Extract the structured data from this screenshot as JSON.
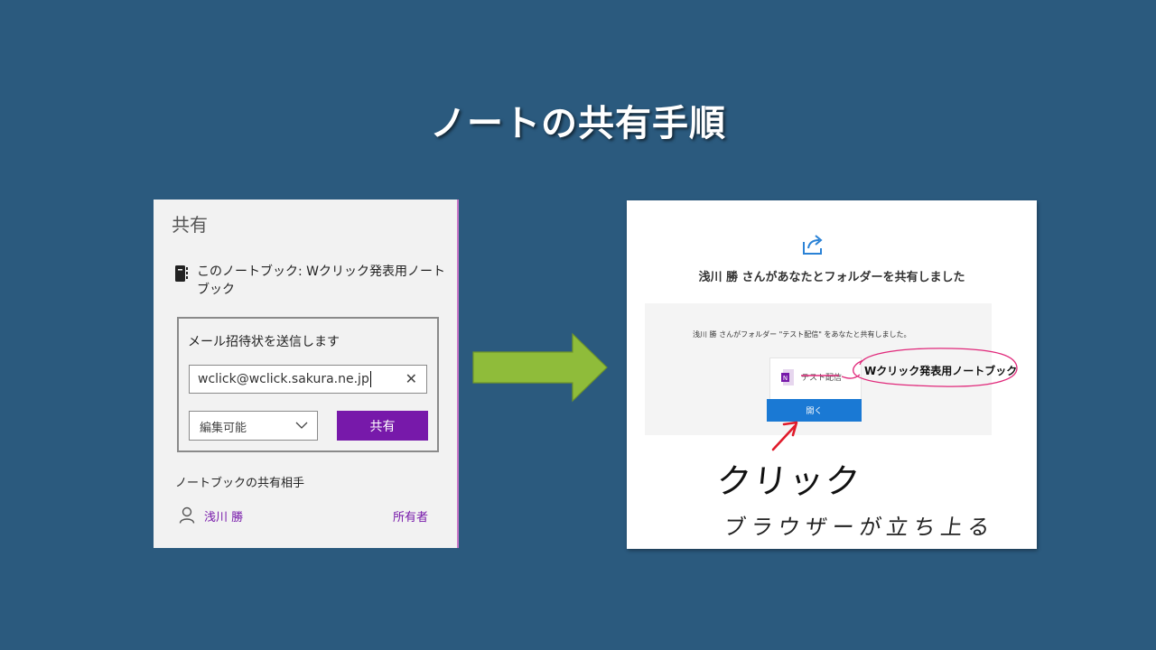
{
  "slide": {
    "title": "ノートの共有手順"
  },
  "share_panel": {
    "title": "共有",
    "notebook_text": "このノートブック: Wクリック発表用ノートブック",
    "invite_label": "メール招待状を送信します",
    "email_value": "wclick@wclick.sakura.ne.jp",
    "permission_value": "編集可能",
    "share_button": "共有",
    "shared_with_label": "ノートブックの共有相手",
    "person_name": "浅川 勝",
    "person_role": "所有者"
  },
  "email_panel": {
    "heading": "浅川 勝 さんがあなたとフォルダーを共有しました",
    "body_text": "浅川 勝 さんがフォルダー \"テスト配信\" をあなたと共有しました。",
    "folder_name": "テスト配信",
    "open_button": "開く",
    "callout_text": "Wクリック発表用ノートブック",
    "handwriting_1": "クリック",
    "handwriting_2": "ブラウザーが立ち上る"
  },
  "colors": {
    "background": "#2b5a7e",
    "accent_purple": "#7719aa",
    "open_blue": "#1a79d4",
    "arrow_green": "#8fbc3a",
    "annotation_pink": "#e0287a",
    "annotation_red": "#e01a2a"
  },
  "icons": [
    "notebook-icon",
    "close-icon",
    "chevron-down-icon",
    "person-icon",
    "share-icon",
    "onenote-icon",
    "right-arrow-icon"
  ]
}
